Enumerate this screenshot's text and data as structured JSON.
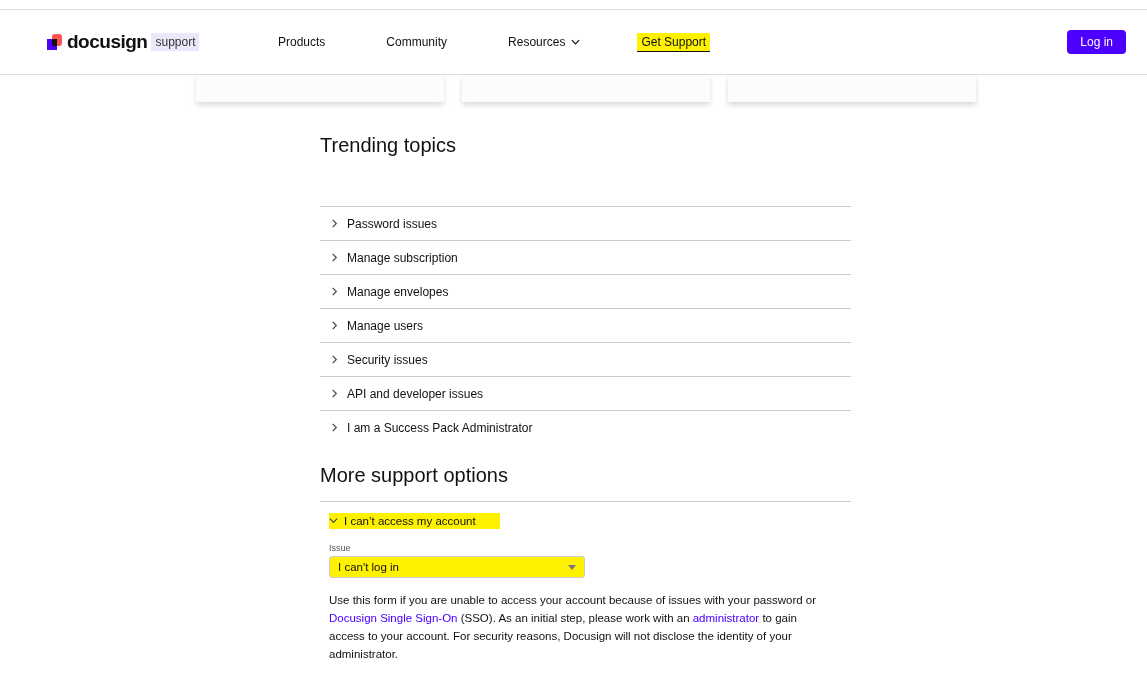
{
  "header": {
    "logo": {
      "wordmark": "docusign",
      "badge": "support"
    },
    "nav": [
      {
        "label": "Products",
        "dropdown": false,
        "highlighted": false
      },
      {
        "label": "Community",
        "dropdown": false,
        "highlighted": false
      },
      {
        "label": "Resources",
        "dropdown": true,
        "highlighted": false
      },
      {
        "label": "Get Support",
        "dropdown": false,
        "highlighted": true
      }
    ],
    "login_button": "Log in"
  },
  "trending": {
    "title": "Trending topics",
    "items": [
      {
        "label": "Password issues",
        "expanded": false
      },
      {
        "label": "Manage subscription",
        "expanded": false
      },
      {
        "label": "Manage envelopes",
        "expanded": false
      },
      {
        "label": "Manage users",
        "expanded": false
      },
      {
        "label": "Security issues",
        "expanded": false
      },
      {
        "label": "API and developer issues",
        "expanded": false
      },
      {
        "label": "I am a Success Pack Administrator",
        "expanded": false
      }
    ]
  },
  "support_options": {
    "title": "More support options",
    "items": [
      {
        "label": "I can’t access my account",
        "expanded": true,
        "highlighted": true,
        "issue_label": "Issue",
        "issue_value": "I can't log in",
        "issue_highlighted": true,
        "description": [
          {
            "text": "Use this form if you are unable to access your account because of issues with your password or "
          },
          {
            "text": "Docusign Single Sign-On",
            "link": true
          },
          {
            "text": " (SSO). As an initial step, please work with an "
          },
          {
            "text": "administrator",
            "link": true
          },
          {
            "text": " to gain access to your account. For security reasons, Docusign will not disclose the identity of your administrator."
          }
        ]
      }
    ]
  }
}
